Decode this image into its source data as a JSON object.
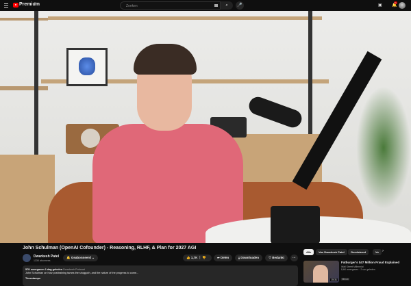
{
  "header": {
    "brand": "Premium",
    "country": "NL",
    "search_placeholder": "Zoeken",
    "notifications": "9+"
  },
  "video": {
    "title": "John Schulman (OpenAI Cofounder) - Reasoning, RLHF, & Plan for 2027 AGI",
    "channel": "Dwarkesh Patel",
    "subscribers": "133K abonnees",
    "subscribe_label": "Geabonneerd",
    "likes": "1,7K",
    "share": "Delen",
    "download": "Downloaden",
    "thanks": "Bedankt",
    "views_date": "57K weergaven  1 dag geleden",
    "hashtag": "Dwarkesh Podcast",
    "description": "John Schulman on how posttraining tames the shoggoth, and the nature of the progress to come...",
    "more": "Timestamps"
  },
  "chips": [
    "Alle",
    "Van Dwarkesh Patel",
    "Gerelateerd",
    "Vo"
  ],
  "recommended": [
    {
      "title": "Fatburger's $47 Million Fraud Explained",
      "channel": "Wall Street Millennial",
      "meta": "8,6K weergaven · 2 uur geleden",
      "badge": "Nieuw",
      "duration": "15:31"
    }
  ]
}
